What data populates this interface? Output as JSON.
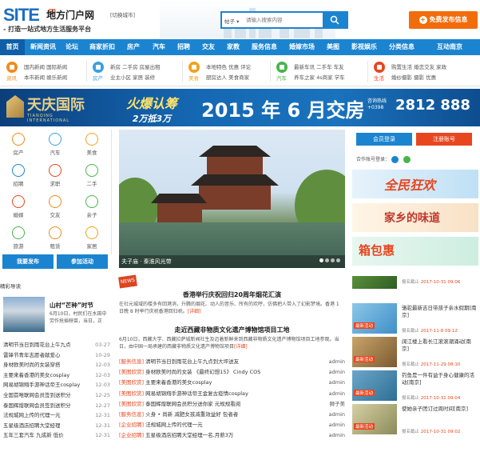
{
  "header": {
    "logo_site": "SITE",
    "logo_cn": ".cn",
    "logo_name": "地方门户网",
    "switch_city": "[切换城市]",
    "slogan": "- 打造一站式地方生活服务平台",
    "search_type": "帖子 ▾",
    "search_placeholder": "请输入搜索内容",
    "post_button": "免费发布信息",
    "post_icon": "+"
  },
  "nav": [
    "首页",
    "新闻资讯",
    "论坛",
    "商家折扣",
    "房产",
    "汽车",
    "招聘",
    "交友",
    "家教",
    "服务信息",
    "婚嫁市场",
    "美图",
    "影视娱乐",
    "分类信息",
    "互动南京"
  ],
  "subnav": [
    {
      "title": "资讯",
      "color": "#f28a1d",
      "links": [
        "国内新闻 国际新闻",
        "本市新闻 娱乐新闻"
      ]
    },
    {
      "title": "房产",
      "color": "#3aa0e0",
      "links": [
        "新房 二手房 房屋出租",
        "业主小区 家居 装修"
      ]
    },
    {
      "title": "美食",
      "color": "#f2a21d",
      "links": [
        "本地特色 优惠 评论",
        "厨房达人 美食商家"
      ]
    },
    {
      "title": "汽车",
      "color": "#47b54a",
      "links": [
        "最新车讯 二手车 车友",
        "养车之家 4s商家 学车"
      ]
    },
    {
      "title": "生活",
      "color": "#e8461e",
      "links": [
        "购置生活 婚恋交友 家政",
        "婚纱摄影 摄影 优惠"
      ]
    }
  ],
  "banner": {
    "brand_cn": "天庆国际",
    "brand_en": "TIANQING INTERNATIONAL",
    "hot_line1": "火爆认筹",
    "hot_line2": "2万抵3万",
    "date": "2015 年 6 月交房",
    "tel_label": "咨询热线 +0398",
    "tel": "2812 888"
  },
  "categories": [
    {
      "label": "房产",
      "color": "#f28a1d"
    },
    {
      "label": "汽车",
      "color": "#3aa0e0"
    },
    {
      "label": "美食",
      "color": "#f2a21d"
    },
    {
      "label": "招聘",
      "color": "#1b84d0"
    },
    {
      "label": "求职",
      "color": "#e8461e"
    },
    {
      "label": "二手",
      "color": "#47b54a"
    },
    {
      "label": "婚嫁",
      "color": "#e8461e"
    },
    {
      "label": "交友",
      "color": "#f28a1d"
    },
    {
      "label": "亲子",
      "color": "#47b54a"
    },
    {
      "label": "旅游",
      "color": "#47b54a"
    },
    {
      "label": "租赁",
      "color": "#f28a1d"
    },
    {
      "label": "家居",
      "color": "#f2a21d"
    }
  ],
  "left_buttons": {
    "post": "我要发布",
    "activity": "参加活动"
  },
  "slider": {
    "caption": "夫子庙 · 秦淮风光带"
  },
  "right_panel": {
    "login": "会员登录",
    "register": "注册账号",
    "oauth_label": "合作账号登录："
  },
  "ads": [
    "全民狂欢",
    "家乡的味道",
    "箱包惠"
  ],
  "news_left": {
    "section_title": "精彩导读",
    "feature_title": "山村“芒种”时节",
    "feature_desc": "6月10日，村民们在水田中劳作抢插秧苗，当日，正",
    "items": [
      {
        "title": "清明节当日到雨花台上午九点",
        "date": "03-27"
      },
      {
        "title": "雷锋节青年志愿者献爱心",
        "date": "10-29"
      },
      {
        "title": "身材欧美时尚的女装穿搭",
        "date": "12-03"
      },
      {
        "title": "主要来着香港的美女cosplay",
        "date": "12-03"
      },
      {
        "title": "网易胡锦翔手游神话帝王cosplay",
        "date": "12-03"
      },
      {
        "title": "全国首唯联网会员签到送积分",
        "date": "12-25"
      },
      {
        "title": "泰国辉煌联网会员签到送积分",
        "date": "12-27"
      },
      {
        "title": "法规城网上传的代理一元",
        "date": "12-31"
      },
      {
        "title": "五星级酒店招聘大堂经理",
        "date": "12-31"
      },
      {
        "title": "五年三套汽车 九成新 低价",
        "date": "12-31"
      }
    ]
  },
  "news_center": {
    "badge": "NEWS",
    "headline1": "香港举行庆祝回归20周年烟花汇演",
    "desc1": "在社元城域的楼多有回港消，升腾的烟花、动人的音乐、所有的欢呼，仿佛把人带入了幻影梦境。香港 1 日晚 8 时举行庆祝香港回归祝。",
    "more1": "[详细]",
    "headline2": "走近西藏非物质文化遗产博物馆项目工地",
    "desc2": "6月10日，西藏大学、西藏拉萨城新闻社生及迈着新鲜来到西藏非物质文化遗产博物馆项目工地参观。当日，由中国一局承建的西藏非物质文化遗产博物馆项目",
    "more2": "[详细]",
    "list": [
      {
        "tag": "[服务信息]",
        "title": "清明节当日到雨花台上午九点到大坪送友",
        "author": "admin"
      },
      {
        "tag": "[美图欣赏]",
        "title": "身材欧美时尚的女装 《最终幻想15》 Cindy COS",
        "author": "admin"
      },
      {
        "tag": "[美图欣赏]",
        "title": "主要来着香港的美女cosplay",
        "author": "admin"
      },
      {
        "tag": "[美图欣赏]",
        "title": "网易胡锦翔手游神话帝王金复古疫情cosplay",
        "author": "admin"
      },
      {
        "tag": "[美图欣赏]",
        "title": "泰国辉煌联网会员积分送你家 元规规看阅",
        "author": "狮子美"
      },
      {
        "tag": "[服务信息]",
        "title": "火身 • 尚新 减肥女孩减重效益好 包者者",
        "author": "admin"
      },
      {
        "tag": "[企业招聘]",
        "title": "法规城网上传的代理一元",
        "author": "admin"
      },
      {
        "tag": "[企业招聘]",
        "title": "五星级酒店招聘大堂经理一名,月薪3万",
        "author": "admin"
      }
    ]
  },
  "activities": [
    {
      "badge": "",
      "title": "",
      "meta_label": "报名截止",
      "time": "2017-10-31 09:06"
    },
    {
      "badge": "最新活动",
      "title": "骆驼最新吉日带孩子亲水假期[南京]",
      "meta_label": "报名截止",
      "time": "2017-11-8 09:12"
    },
    {
      "badge": "最新活动",
      "title": "阔江楼上看长江滚滚潮涌动[南京]",
      "meta_label": "报名截止",
      "time": "2017-11-29 08:10"
    },
    {
      "badge": "最新活动",
      "title": "钓鱼是一件有益于身心健康的活动[南京]",
      "meta_label": "报名截止",
      "time": "2017-10-31 09:04"
    },
    {
      "badge": "最新活动",
      "title": "使她亲子团订过周时间[南京]",
      "meta_label": "报名截止",
      "time": "2017-10-31 09:02"
    }
  ]
}
